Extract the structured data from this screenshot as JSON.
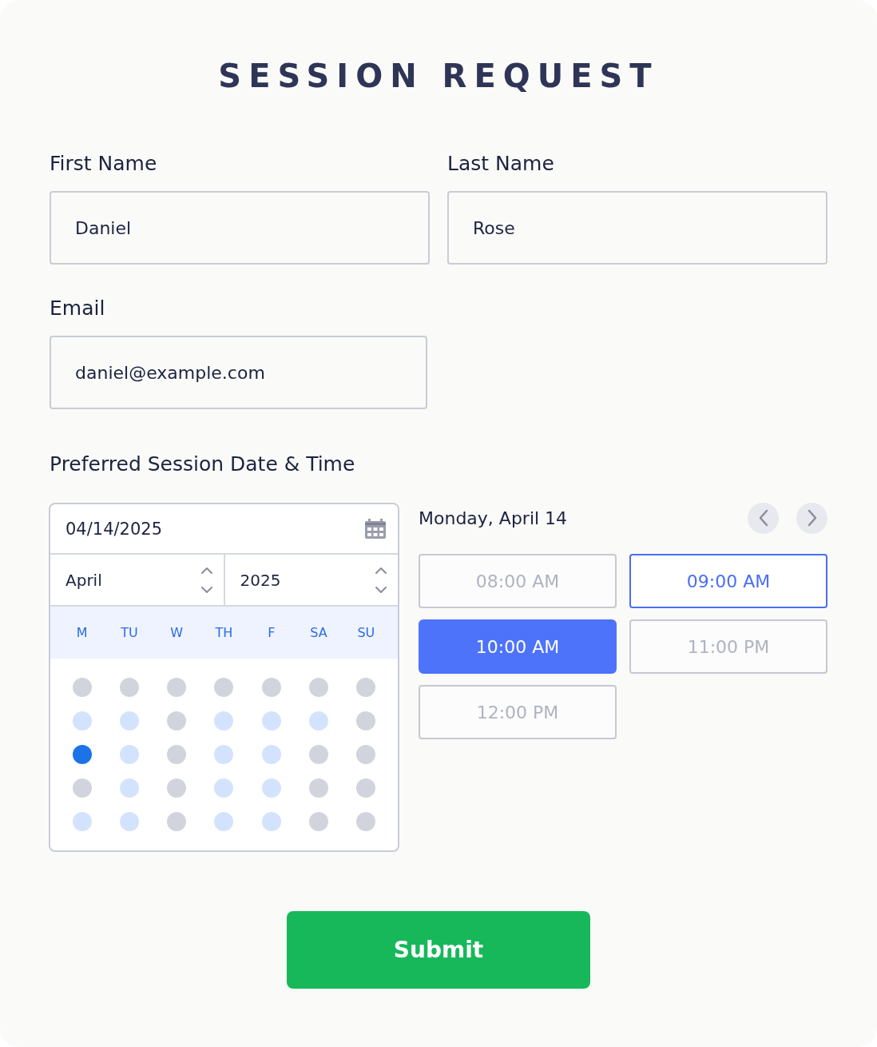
{
  "title": "SESSION REQUEST",
  "fields": [
    {
      "label": "First Name",
      "value": "Daniel"
    },
    {
      "label": "Last Name",
      "value": "Rose"
    },
    {
      "label": "Email",
      "value": "daniel@example.com"
    }
  ],
  "schedule": {
    "label": "Preferred Session Date & Time",
    "date_value": "04/14/2025",
    "month": "April",
    "year": "2025",
    "weekdays": [
      "M",
      "TU",
      "W",
      "TH",
      "F",
      "SA",
      "SU"
    ],
    "days": [
      [
        {
          "available": false,
          "selected": false
        },
        {
          "available": false,
          "selected": false
        },
        {
          "available": false,
          "selected": false
        },
        {
          "available": false,
          "selected": false
        },
        {
          "available": false,
          "selected": false
        },
        {
          "available": false,
          "selected": false
        },
        {
          "available": false,
          "selected": false
        }
      ],
      [
        {
          "available": true,
          "selected": false
        },
        {
          "available": true,
          "selected": false
        },
        {
          "available": false,
          "selected": false
        },
        {
          "available": true,
          "selected": false
        },
        {
          "available": true,
          "selected": false
        },
        {
          "available": true,
          "selected": false
        },
        {
          "available": false,
          "selected": false
        }
      ],
      [
        {
          "available": true,
          "selected": true
        },
        {
          "available": true,
          "selected": false
        },
        {
          "available": false,
          "selected": false
        },
        {
          "available": true,
          "selected": false
        },
        {
          "available": true,
          "selected": false
        },
        {
          "available": false,
          "selected": false
        },
        {
          "available": false,
          "selected": false
        }
      ],
      [
        {
          "available": false,
          "selected": false
        },
        {
          "available": true,
          "selected": false
        },
        {
          "available": false,
          "selected": false
        },
        {
          "available": true,
          "selected": false
        },
        {
          "available": true,
          "selected": false
        },
        {
          "available": false,
          "selected": false
        },
        {
          "available": false,
          "selected": false
        }
      ],
      [
        {
          "available": true,
          "selected": false
        },
        {
          "available": true,
          "selected": false
        },
        {
          "available": false,
          "selected": false
        },
        {
          "available": true,
          "selected": false
        },
        {
          "available": true,
          "selected": false
        },
        {
          "available": false,
          "selected": false
        },
        {
          "available": false,
          "selected": false
        }
      ]
    ],
    "day_heading": "Monday, April 14",
    "slots": [
      {
        "label": "08:00 AM",
        "selected": false,
        "highlighted": false,
        "disabled": true
      },
      {
        "label": "09:00 AM",
        "selected": false,
        "highlighted": true,
        "disabled": false
      },
      {
        "label": "10:00 AM",
        "selected": true,
        "highlighted": false,
        "disabled": false
      },
      {
        "label": "11:00 PM",
        "selected": false,
        "highlighted": false,
        "disabled": true
      },
      {
        "label": "12:00 PM",
        "selected": false,
        "highlighted": false,
        "disabled": true
      }
    ]
  },
  "submit": "Submit"
}
